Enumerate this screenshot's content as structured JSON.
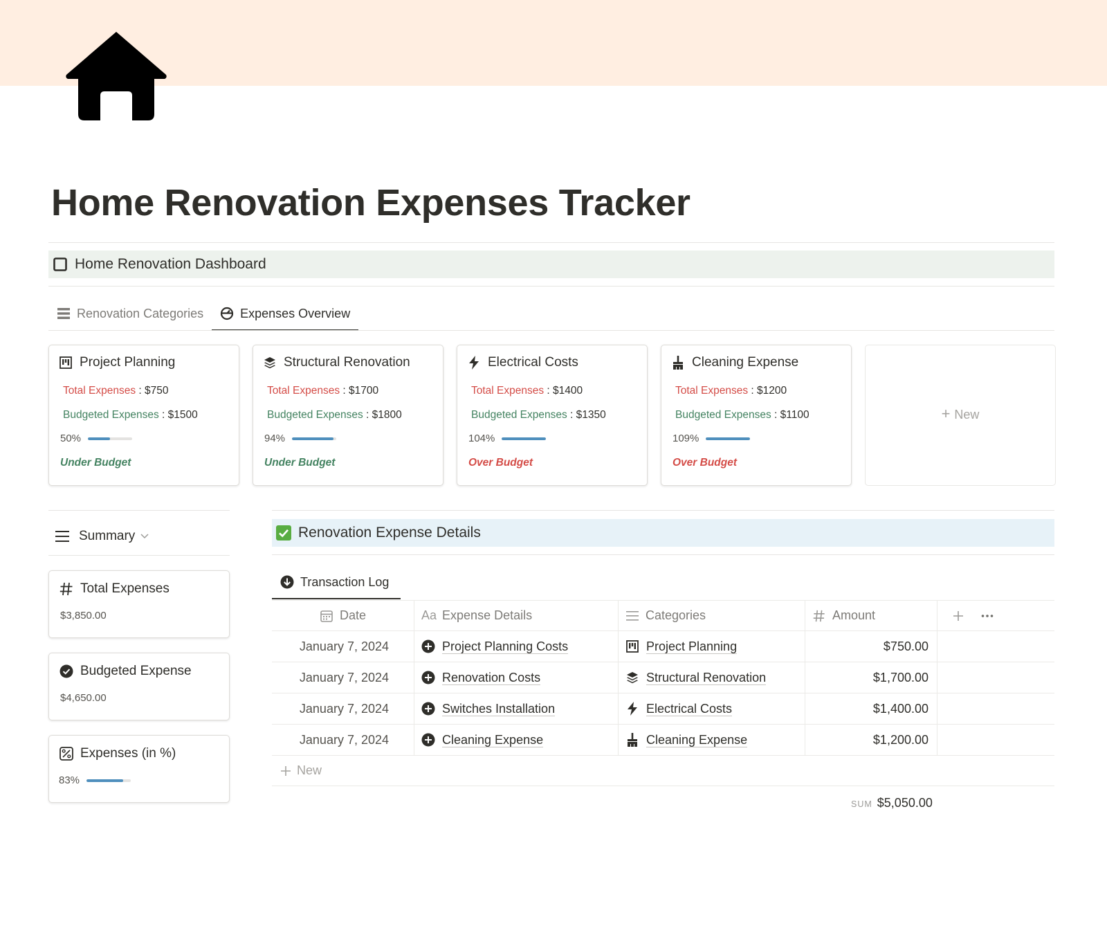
{
  "colors": {
    "cover": "#ffeee1",
    "callout_dashboard": "#edf2ed",
    "callout_details": "#e7f2f8",
    "total_label": "#d44c47",
    "budget_label": "#448361",
    "progress_fill": "#4f8fbd"
  },
  "page": {
    "icon": "house-icon",
    "title": "Home Renovation Expenses Tracker"
  },
  "dashboard": {
    "icon": "square-outline-icon",
    "title": "Home Renovation Dashboard"
  },
  "tabs": [
    {
      "label": "Renovation Categories",
      "icon": "list-icon",
      "active": false
    },
    {
      "label": "Expenses Overview",
      "icon": "gauge-icon",
      "active": true
    }
  ],
  "cards": [
    {
      "title": "Project Planning",
      "icon": "kanban-icon",
      "total_label": "Total Expenses",
      "sep": " : ",
      "total": "$750",
      "budget_label": "Budgeted Expenses",
      "budget": "$1500",
      "percent_text": "50%",
      "percent": 50,
      "status": "Under Budget",
      "status_color": "#448361"
    },
    {
      "title": "Structural Renovation",
      "icon": "layers-icon",
      "total_label": "Total Expenses",
      "sep": " : ",
      "total": "$1700",
      "budget_label": "Budgeted Expenses",
      "budget": "$1800",
      "percent_text": "94%",
      "percent": 94,
      "status": "Under Budget",
      "status_color": "#448361"
    },
    {
      "title": "Electrical Costs",
      "icon": "lightning-icon",
      "total_label": "Total Expenses",
      "sep": " : ",
      "total": "$1400",
      "budget_label": "Budgeted Expenses",
      "budget": "$1350",
      "percent_text": "104%",
      "percent": 104,
      "status": "Over Budget",
      "status_color": "#d44c47"
    },
    {
      "title": "Cleaning Expense",
      "icon": "broom-icon",
      "total_label": "Total Expenses",
      "sep": " : ",
      "total": "$1200",
      "budget_label": "Budgeted Expenses",
      "budget": "$1100",
      "percent_text": "109%",
      "percent": 109,
      "status": "Over Budget",
      "status_color": "#d44c47"
    }
  ],
  "new_card_label": "New",
  "summary": {
    "view_label": "Summary",
    "cards": [
      {
        "title": "Total Expenses",
        "icon": "hash-icon",
        "value": "$3,850.00"
      },
      {
        "title": "Budgeted Expense",
        "icon": "check-circle-icon",
        "value": "$4,650.00"
      },
      {
        "title": "Expenses (in %)",
        "icon": "percent-icon",
        "percent_text": "83%",
        "percent": 83
      }
    ]
  },
  "details": {
    "icon": "checkbox-checked-icon",
    "title": "Renovation Expense Details",
    "tab_label": "Transaction Log",
    "tab_icon": "arrow-down-circle-icon",
    "columns": {
      "date": "Date",
      "details": "Expense Details",
      "details_prefix": "Aa",
      "categories": "Categories",
      "amount": "Amount"
    },
    "rows": [
      {
        "date": "January 7, 2024",
        "detail": "Project Planning Costs",
        "category": "Project Planning",
        "category_icon": "kanban-icon",
        "amount": "$750.00"
      },
      {
        "date": "January 7, 2024",
        "detail": "Renovation Costs",
        "category": "Structural Renovation",
        "category_icon": "layers-icon",
        "amount": "$1,700.00"
      },
      {
        "date": "January 7, 2024",
        "detail": "Switches Installation",
        "category": "Electrical Costs",
        "category_icon": "lightning-icon",
        "amount": "$1,400.00"
      },
      {
        "date": "January 7, 2024",
        "detail": "Cleaning Expense",
        "category": "Cleaning Expense",
        "category_icon": "broom-icon",
        "amount": "$1,200.00"
      }
    ],
    "new_row_label": "New",
    "sum_label": "SUM",
    "sum_value": "$5,050.00"
  }
}
